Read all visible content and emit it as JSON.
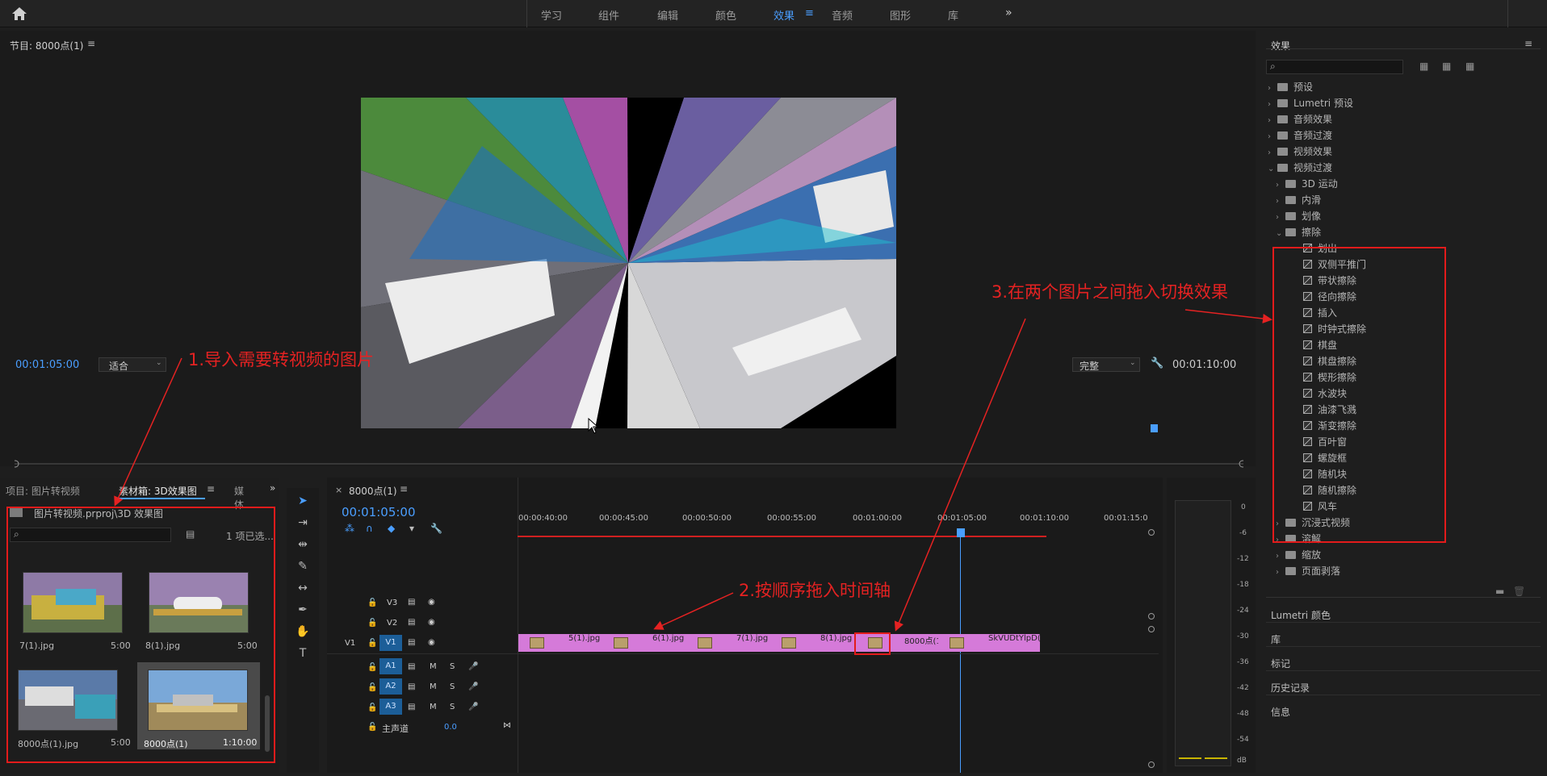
{
  "workspaces": {
    "items": [
      "学习",
      "组件",
      "编辑",
      "颜色",
      "效果",
      "音频",
      "图形",
      "库"
    ],
    "active": "效果"
  },
  "program": {
    "title": "节目: 8000点(1)",
    "timecode_left": "00:01:05:00",
    "fit": "适合",
    "quality": "完整",
    "timecode_right": "00:01:10:00"
  },
  "project": {
    "tab1": "项目: 图片转视频",
    "tab2": "素材箱: 3D效果图",
    "tab3": "媒体",
    "bin_path": "图片转视频.prproj\\3D 效果图",
    "selected_count": "1 项已选...",
    "items": [
      {
        "name": "7(1).jpg",
        "duration": "5:00"
      },
      {
        "name": "8(1).jpg",
        "duration": "5:00"
      },
      {
        "name": "8000点(1).jpg",
        "duration": "5:00"
      },
      {
        "name": "8000点(1)",
        "duration": "1:10:00"
      }
    ]
  },
  "timeline": {
    "title": "8000点(1)",
    "timecode": "00:01:05:00",
    "ruler": [
      "00:00:40:00",
      "00:00:45:00",
      "00:00:50:00",
      "00:00:55:00",
      "00:01:00:00",
      "00:01:05:00",
      "00:01:10:00",
      "00:01:15:0"
    ],
    "tracks": {
      "v3": "V3",
      "v2": "V2",
      "v1": "V1",
      "v1_src": "V1",
      "a1": "A1",
      "a2": "A2",
      "a3": "A3",
      "master": "主声道",
      "master_val": "0.0",
      "m": "M",
      "s": "S"
    },
    "clips": [
      "5(1).jpg",
      "6(1).jpg",
      "7(1).jpg",
      "8(1).jpg",
      "8000点(1).j",
      "SkVUDtYlpD(1)"
    ]
  },
  "meter": {
    "ticks": [
      "0",
      "-6",
      "-12",
      "-18",
      "-24",
      "-30",
      "-36",
      "-42",
      "-48",
      "-54",
      "dB"
    ]
  },
  "effects": {
    "title": "效果",
    "top": [
      "预设",
      "Lumetri 预设",
      "音频效果",
      "音频过渡",
      "视频效果",
      "视频过渡"
    ],
    "video_transitions": [
      "3D 运动",
      "内滑",
      "划像",
      "擦除"
    ],
    "wipe_items": [
      "划出",
      "双侧平推门",
      "带状擦除",
      "径向擦除",
      "插入",
      "时钟式擦除",
      "棋盘",
      "棋盘擦除",
      "楔形擦除",
      "水波块",
      "油漆飞溅",
      "渐变擦除",
      "百叶窗",
      "螺旋框",
      "随机块",
      "随机擦除",
      "风车"
    ],
    "after": [
      "沉浸式视频",
      "溶解",
      "缩放",
      "页面剥落"
    ],
    "panels": [
      "Lumetri 颜色",
      "库",
      "标记",
      "历史记录",
      "信息"
    ]
  },
  "annotations": {
    "a1": "1.导入需要转视频的图片",
    "a2": "2.按顺序拖入时间轴",
    "a3": "3.在两个图片之间拖入切换效果"
  },
  "colors": {
    "accent": "#4a9eff",
    "clip": "#d57ad9",
    "annotation": "#e52222",
    "target": "#1c5e98"
  }
}
